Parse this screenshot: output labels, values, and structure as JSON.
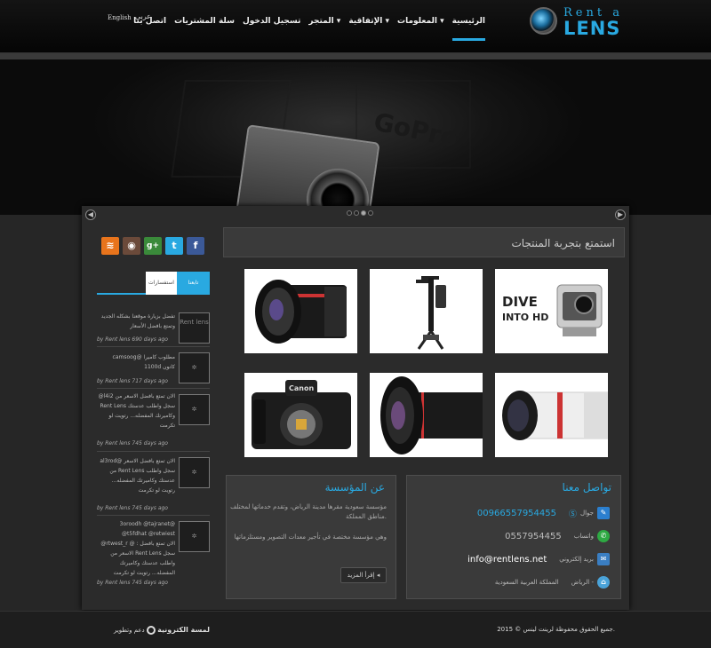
{
  "logo": {
    "line1": "Rent a",
    "line2": "LENS"
  },
  "nav": {
    "items": [
      {
        "label": "الرئيسية",
        "active": true
      },
      {
        "label": "المعلومات ▾"
      },
      {
        "label": "الإتفاقية ▾"
      },
      {
        "label": "المتجر ▾"
      },
      {
        "label": "تسجيل الدخول"
      },
      {
        "label": "سلة المشتريات"
      },
      {
        "label": "اتصل بنا"
      }
    ],
    "lang_ar": "عربي",
    "lang_en": "English"
  },
  "slider": {
    "prev": "◀",
    "next": "▶",
    "dots": 4,
    "active_dot": 3
  },
  "social": {
    "icons": [
      "facebook-icon",
      "twitter-icon",
      "googleplus-icon",
      "instagram-icon",
      "rss-icon"
    ],
    "labels": [
      "f",
      "t",
      "g+",
      "◉",
      "≋"
    ]
  },
  "tweets": {
    "tab_follow": "تابعنا",
    "tab_faq": "استفسارات",
    "items": [
      {
        "avatar": "Rent lens",
        "text": "تفضل بزيارة موقعنا بشكله الجديد وتمتع بافضل الأسعار",
        "meta": "by Rent lens 690 days ago"
      },
      {
        "avatar": "",
        "text": "camsoog@ مطلوب كاميرا 1100d كانون",
        "meta": "by Rent lens 717 days ago"
      },
      {
        "avatar": "",
        "text": "@l4i2 الان تمتع بافضل الاسعر من Rent Lens سجل واطلب عدستك وكاميرتك المفضله... رتويت لو تكرمت",
        "meta": "by Rent lens 745 days ago"
      },
      {
        "avatar": "",
        "text": "al3rod@ الان تمتع بافضل الاسعر من Rent Lens سجل واطلب عدستك وكاميرتك المفضله... رتويت لو تكرمت",
        "meta": "by Rent lens 745 days ago"
      },
      {
        "avatar": "",
        "text": "3oroodh @tajranet@ @t5fdhat @retwiest @rtwest_r @ : الان تمتع بافضل الاسعر من Rent Lens سجل واطلب عدستك وكاميرتك المفضله... رتويت لو تكرمت",
        "meta": "by Rent lens 745 days ago"
      }
    ]
  },
  "products": {
    "title": "استمتع بتجربة المنتجات",
    "items": [
      {
        "name": "lens-canon-l"
      },
      {
        "name": "camera-stabilizer"
      },
      {
        "name": "gopro-dive-hd",
        "caption": "DIVE INTO HD"
      },
      {
        "name": "canon-camera-body",
        "caption": "Canon"
      },
      {
        "name": "fisheye-lens"
      },
      {
        "name": "white-tele-lens"
      }
    ]
  },
  "contact": {
    "title": "تواصل معنا",
    "rows": [
      {
        "label": "جوال",
        "value": "00966557954455",
        "color": "#29a9e1",
        "icon": "phone-icon",
        "iconcolor": "#2b7fcf"
      },
      {
        "label": "واتساب",
        "value": "0557954455",
        "color": "#bbbbbb",
        "icon": "whatsapp-icon",
        "iconcolor": "#2ea943"
      },
      {
        "label": "بريد إلكتروني",
        "value": "info@rentlens.net",
        "color": "#ffffff",
        "icon": "email-icon",
        "iconcolor": "#3a7ec2"
      },
      {
        "label": "الرياض -",
        "value": "المملكة العربية السعودية",
        "color": "#bbbbbb",
        "icon": "location-icon",
        "iconcolor": "#4aa3d9"
      }
    ]
  },
  "about": {
    "title": "عن المؤسسة",
    "p1": "مؤسسة سعودية مقرها مدينة الرياض، وتقدم خدماتها لمختلف مناطق المملكة.",
    "p2": "وهي مؤسسة مختصة في تأجير معدات التصوير ومستلزماتها",
    "more": "إقرأ المزيد"
  },
  "footer": {
    "copyright": "جميع الحقوق محفوظة لرينت لينس © 2015.",
    "dev_label": "دعم وتطوير",
    "dev_name": "لمسة الكترونية"
  }
}
